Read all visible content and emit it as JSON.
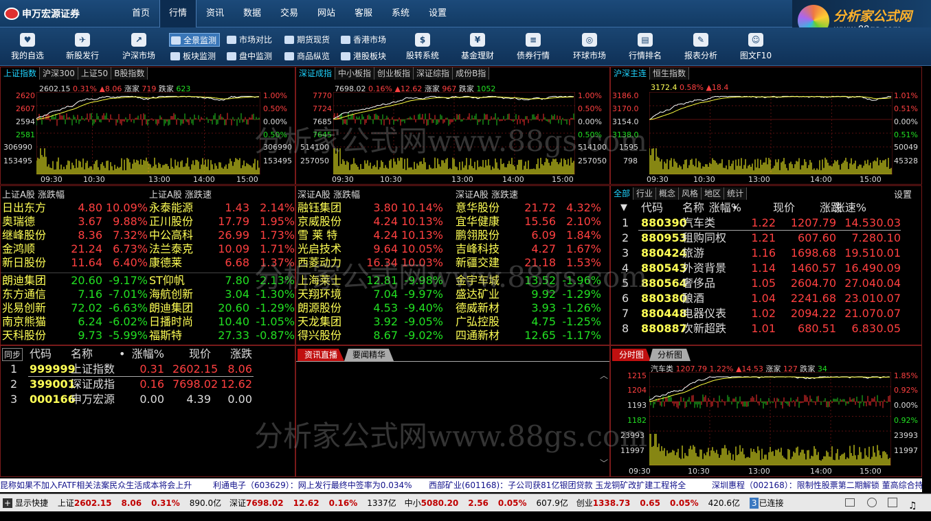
{
  "logo": "申万宏源证券",
  "nav": [
    "首页",
    "行情",
    "资讯",
    "数据",
    "交易",
    "网站",
    "客服",
    "系统",
    "设置"
  ],
  "brand": {
    "title": "分析家公式网",
    "url": "www.88gs.com"
  },
  "toolbar": {
    "big": [
      "我的自选",
      "新股发行",
      "沪深市场",
      "股转系统",
      "基金理财",
      "债券行情",
      "环球市场",
      "行情排名",
      "报表分析",
      "图文F10"
    ],
    "small": [
      "全景监测",
      "板块监测",
      "市场对比",
      "盘中监测",
      "期货现货",
      "商品纵览",
      "香港市场",
      "港股板块"
    ]
  },
  "chart1": {
    "tabs": [
      "上证指数",
      "沪深300",
      "上证50",
      "B股指数"
    ],
    "price": "2602.15",
    "pct": "0.31%",
    "chg": "▲8.06",
    "up_label": "涨家",
    "up": "719",
    "down_label": "跌家",
    "down": "623",
    "yl": [
      "2620",
      "2607",
      "2594",
      "2581",
      "306990",
      "153495"
    ],
    "yr": [
      "1.00%",
      "0.50%",
      "0.00%",
      "0.50%",
      "306990",
      "153495"
    ],
    "times": [
      "09:30",
      "10:30",
      "13:00",
      "14:00",
      "15:00"
    ]
  },
  "chart2": {
    "tabs": [
      "深证成指",
      "中小板指",
      "创业板指",
      "深证综指",
      "成份B指"
    ],
    "price": "7698.02",
    "pct": "0.16%",
    "chg": "▲12.62",
    "up_label": "涨家",
    "up": "967",
    "down_label": "跌家",
    "down": "1052",
    "yl": [
      "7770",
      "7724",
      "7685",
      "7645",
      "514100",
      "257050"
    ],
    "yr": [
      "1.00%",
      "0.50%",
      "0.00%",
      "0.50%",
      "514100",
      "257050"
    ],
    "times": [
      "09:30",
      "10:30",
      "13:00",
      "14:00",
      "15:00"
    ]
  },
  "chart3": {
    "tabs": [
      "沪深主连",
      "恒生指数"
    ],
    "price": "3172.4",
    "pct": "0.58%",
    "chg": "▲18.4",
    "yl": [
      "3186.0",
      "3170.0",
      "3154.0",
      "3138.0",
      "1595",
      "798"
    ],
    "yr": [
      "1.01%",
      "0.51%",
      "0.00%",
      "0.51%",
      "50049",
      "45328"
    ],
    "times": [
      "09:30",
      "10:30",
      "13:00",
      "14:00",
      "15:00"
    ]
  },
  "rank_sh": {
    "h1": "上证A股",
    "h1b": "涨跌幅",
    "h2": "上证A股",
    "h2b": "涨跌速",
    "top": [
      [
        "日出东方",
        "4.80",
        "10.09%"
      ],
      [
        "奥瑞德",
        "3.67",
        "9.88%"
      ],
      [
        "继峰股份",
        "8.36",
        "7.32%"
      ],
      [
        "金鸿顺",
        "21.24",
        "6.73%"
      ],
      [
        "新日股份",
        "11.64",
        "6.40%"
      ]
    ],
    "top2": [
      [
        "永泰能源",
        "1.43",
        "2.14%"
      ],
      [
        "正川股份",
        "17.79",
        "1.95%"
      ],
      [
        "中公高科",
        "26.99",
        "1.73%"
      ],
      [
        "法兰泰克",
        "10.09",
        "1.71%"
      ],
      [
        "康德莱",
        "6.68",
        "1.37%"
      ]
    ],
    "bot": [
      [
        "朗迪集团",
        "20.60",
        "-9.17%"
      ],
      [
        "东方通信",
        "7.16",
        "-7.01%"
      ],
      [
        "兆易创新",
        "72.02",
        "-6.63%"
      ],
      [
        "南京熊猫",
        "6.24",
        "-6.02%"
      ],
      [
        "天科股份",
        "9.73",
        "-5.99%"
      ]
    ],
    "bot2": [
      [
        "ST仰帆",
        "7.80",
        "-2.13%"
      ],
      [
        "海航创新",
        "3.04",
        "-1.30%"
      ],
      [
        "朗迪集团",
        "20.60",
        "-1.29%"
      ],
      [
        "日播时尚",
        "10.40",
        "-1.05%"
      ],
      [
        "福斯特",
        "27.33",
        "-0.87%"
      ]
    ]
  },
  "rank_sz": {
    "h1": "深证A股",
    "h1b": "涨跌幅",
    "h2": "深证A股",
    "h2b": "涨跌速",
    "top": [
      [
        "融钰集团",
        "3.80",
        "10.14%"
      ],
      [
        "京威股份",
        "4.24",
        "10.13%"
      ],
      [
        "雪 莱 特",
        "4.24",
        "10.13%"
      ],
      [
        "光启技术",
        "9.64",
        "10.05%"
      ],
      [
        "西菱动力",
        "16.34",
        "10.03%"
      ]
    ],
    "top2": [
      [
        "意华股份",
        "21.72",
        "4.32%"
      ],
      [
        "宜华健康",
        "15.56",
        "2.10%"
      ],
      [
        "鹏翎股份",
        "6.09",
        "1.84%"
      ],
      [
        "吉峰科技",
        "4.27",
        "1.67%"
      ],
      [
        "新疆交建",
        "21.18",
        "1.53%"
      ]
    ],
    "bot": [
      [
        "上海莱士",
        "12.81",
        "-9.98%"
      ],
      [
        "天翔环境",
        "7.04",
        "-9.97%"
      ],
      [
        "朗源股份",
        "4.53",
        "-9.40%"
      ],
      [
        "天龙集团",
        "3.92",
        "-9.05%"
      ],
      [
        "得兴股份",
        "8.67",
        "-9.02%"
      ]
    ],
    "bot2": [
      [
        "金宇车城",
        "13.52",
        "-1.96%"
      ],
      [
        "盛达矿业",
        "9.92",
        "-1.29%"
      ],
      [
        "德威新材",
        "3.93",
        "-1.26%"
      ],
      [
        "广弘控股",
        "4.75",
        "-1.25%"
      ],
      [
        "四通新材",
        "12.65",
        "-1.17%"
      ]
    ]
  },
  "sector": {
    "tabs": [
      "全部",
      "行业",
      "概念",
      "风格",
      "地区",
      "统计"
    ],
    "setting": "设置",
    "cols": [
      "代码",
      "名称",
      "•",
      "涨幅%",
      "现价",
      "涨跌",
      "涨速%"
    ],
    "rows": [
      [
        "1",
        "880390",
        "汽车类",
        "1.22",
        "1207.79",
        "14.53",
        "0.03"
      ],
      [
        "2",
        "880953",
        "租购同权",
        "1.21",
        "607.60",
        "7.28",
        "0.10"
      ],
      [
        "3",
        "880424",
        "旅游",
        "1.16",
        "1698.68",
        "19.51",
        "0.01"
      ],
      [
        "4",
        "880543",
        "外资背景",
        "1.14",
        "1460.57",
        "16.49",
        "0.09"
      ],
      [
        "5",
        "880564",
        "奢侈品",
        "1.05",
        "2604.70",
        "27.04",
        "0.04"
      ],
      [
        "6",
        "880380",
        "酿酒",
        "1.04",
        "2241.68",
        "23.01",
        "0.07"
      ],
      [
        "7",
        "880448",
        "电器仪表",
        "1.02",
        "2094.22",
        "21.07",
        "0.07"
      ],
      [
        "8",
        "880887",
        "次新超跌",
        "1.01",
        "680.51",
        "6.83",
        "0.05"
      ]
    ]
  },
  "index_list": {
    "sync": "同步",
    "cols": [
      "代码",
      "名称",
      "•",
      "涨幅%",
      "现价",
      "涨跌"
    ],
    "rows": [
      [
        "1",
        "999999",
        "上证指数",
        "0.31",
        "2602.15",
        "8.06"
      ],
      [
        "2",
        "399001",
        "深证成指",
        "0.16",
        "7698.02",
        "12.62"
      ],
      [
        "3",
        "000166",
        "申万宏源",
        "0.00",
        "4.39",
        "0.00"
      ]
    ]
  },
  "news": {
    "tab1": "资讯直播",
    "tab2": "要闻精华"
  },
  "mini": {
    "tab1": "分时图",
    "tab2": "分析图",
    "name": "汽车类",
    "price": "1207.79",
    "pct": "1.22%",
    "chg": "▲14.53",
    "up_label": "涨家",
    "up": "127",
    "down_label": "跌家",
    "down": "34",
    "yl": [
      "1215",
      "1204",
      "1193",
      "1182",
      "23993",
      "11997"
    ],
    "yr": [
      "1.85%",
      "0.92%",
      "0.00%",
      "0.92%",
      "23993",
      "11997"
    ],
    "times": [
      "09:30",
      "10:30",
      "13:00",
      "14:00",
      "15:00"
    ]
  },
  "ticker": [
    "昆称如果不加入FATF相关法案民众生活成本将会上升",
    "利通电子（603629）：网上发行最终中签率为0.034%",
    "西部矿业(601168)：子公司获81亿银团贷款 玉龙铜矿改扩建工程将全",
    "深圳惠程（002168）：限制性股票第二期解锁 董高综合持"
  ],
  "status": {
    "shortcut": "显示快捷",
    "sh_label": "上证",
    "sh": "2602.15",
    "sh_chg": "8.06",
    "sh_pct": "0.31%",
    "sh_amt": "890.0亿",
    "sz_label": "深证",
    "sz": "7698.02",
    "sz_chg": "12.62",
    "sz_pct": "0.16%",
    "sz_amt": "1337亿",
    "zx_label": "中小",
    "zx": "5080.20",
    "zx_chg": "2.56",
    "zx_pct": "0.05%",
    "zx_amt": "607.9亿",
    "cy_label": "创业",
    "cy": "1338.73",
    "cy_chg": "0.65",
    "cy_pct": "0.05%",
    "cy_amt": "420.6亿",
    "conn_num": "3",
    "conn": "已连接"
  },
  "watermark": "分析家公式网www.88gs.com"
}
